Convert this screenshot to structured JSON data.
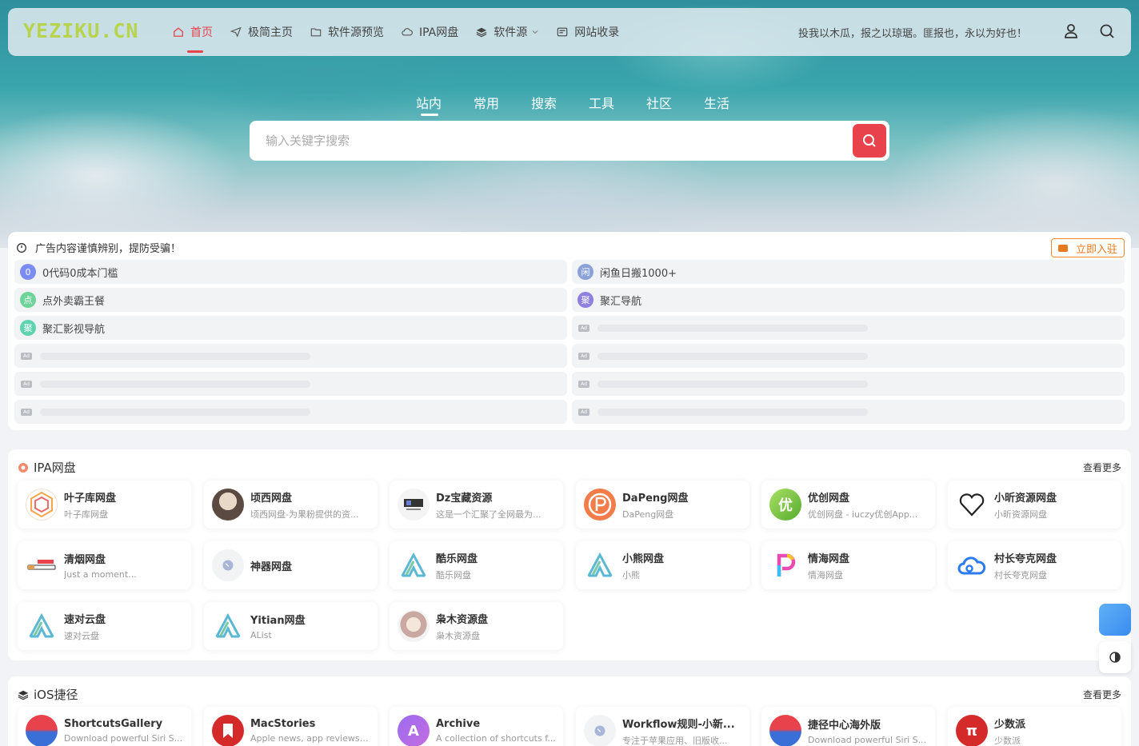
{
  "header": {
    "logo": "YEZIKU.CN",
    "nav": [
      {
        "label": "首页",
        "icon": "home-icon",
        "active": true
      },
      {
        "label": "极简主页",
        "icon": "send-icon"
      },
      {
        "label": "软件源预览",
        "icon": "folder-icon"
      },
      {
        "label": "IPA网盘",
        "icon": "cloud-icon"
      },
      {
        "label": "软件源",
        "icon": "layers-icon"
      },
      {
        "label": "网站收录",
        "icon": "inbox-icon"
      }
    ],
    "slogan": "投我以木瓜，报之以琼琚。匪报也，永以为好也！"
  },
  "search": {
    "tabs": [
      "站内",
      "常用",
      "搜索",
      "工具",
      "社区",
      "生活"
    ],
    "placeholder": "输入关键字搜索"
  },
  "ads": {
    "notice": "广告内容谨慎辨别，提防受骗！",
    "join_label": "立即入驻",
    "ad_tag": "Ad",
    "items": [
      {
        "avatar": "0",
        "label": "0代码0成本门槛",
        "color": "#7b8cf0"
      },
      {
        "avatar": "闲",
        "label": "闲鱼日搬1000+",
        "color": "#8aa2d8"
      },
      {
        "avatar": "点",
        "label": "点外卖霸王餐",
        "color": "#6fd49a"
      },
      {
        "avatar": "聚",
        "label": "聚汇导航",
        "color": "#8f7fe0"
      },
      {
        "avatar": "聚",
        "label": "聚汇影视导航",
        "color": "#5fd3b0"
      }
    ]
  },
  "sections": [
    {
      "title": "IPA网盘",
      "more": "查看更多",
      "cards": [
        {
          "name": "叶子库网盘",
          "desc": "叶子库网盘"
        },
        {
          "name": "顷西网盘",
          "desc": "顷西网盘-为果粉提供的资..."
        },
        {
          "name": "Dz宝藏资源",
          "desc": "这是一个汇聚了全网最为..."
        },
        {
          "name": "DaPeng网盘",
          "desc": "DaPeng网盘"
        },
        {
          "name": "优创网盘",
          "desc": "优创网盘 - iuczy优创App..."
        },
        {
          "name": "小昕资源网盘",
          "desc": "小昕资源网盘"
        },
        {
          "name": "清烟网盘",
          "desc": "Just a moment..."
        },
        {
          "name": "神器网盘",
          "desc": ""
        },
        {
          "name": "酷乐网盘",
          "desc": "酷乐网盘"
        },
        {
          "name": "小熊网盘",
          "desc": "小熊"
        },
        {
          "name": "情海网盘",
          "desc": "情海网盘"
        },
        {
          "name": "村长夸克网盘",
          "desc": "村长夸克网盘"
        },
        {
          "name": "速对云盘",
          "desc": "速对云盘"
        },
        {
          "name": "Yitian网盘",
          "desc": "AList"
        },
        {
          "name": "枭木资源盘",
          "desc": "枭木资源盘"
        }
      ]
    },
    {
      "title": "iOS捷径",
      "more": "查看更多",
      "cards": [
        {
          "name": "ShortcutsGallery",
          "desc": "Download powerful Siri S..."
        },
        {
          "name": "MacStories",
          "desc": "Apple news, app reviews,..."
        },
        {
          "name": "Archive",
          "desc": "A collection of shortcuts f..."
        },
        {
          "name": "Workflow规则-小新...",
          "desc": "专注于苹果应用、旧版收..."
        },
        {
          "name": "捷径中心海外版",
          "desc": "Download powerful Siri S..."
        },
        {
          "name": "少数派",
          "desc": "少数派"
        }
      ]
    }
  ],
  "colors": {
    "accent": "#e8434c",
    "ad_orange": "#e87a1e"
  }
}
